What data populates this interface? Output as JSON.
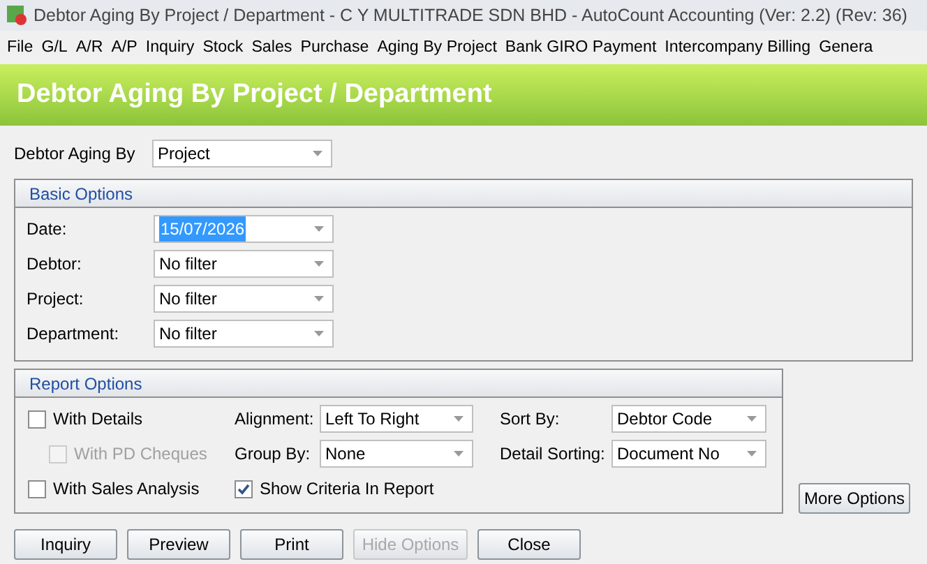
{
  "window": {
    "title": "Debtor Aging By Project / Department - C Y MULTITRADE SDN BHD - AutoCount Accounting (Ver: 2.2) (Rev: 36)"
  },
  "menu": [
    "File",
    "G/L",
    "A/R",
    "A/P",
    "Inquiry",
    "Stock",
    "Sales",
    "Purchase",
    "Aging By Project",
    "Bank GIRO Payment",
    "Intercompany Billing",
    "Genera"
  ],
  "banner": "Debtor Aging By Project / Department",
  "aging_by": {
    "label": "Debtor Aging By",
    "value": "Project"
  },
  "basic_options": {
    "title": "Basic Options",
    "fields": [
      {
        "label": "Date:",
        "value": "15/07/2026",
        "selected": true
      },
      {
        "label": "Debtor:",
        "value": "No filter",
        "selected": false
      },
      {
        "label": "Project:",
        "value": "No filter",
        "selected": false
      },
      {
        "label": "Department:",
        "value": "No filter",
        "selected": false
      }
    ]
  },
  "report_options": {
    "title": "Report Options",
    "checkboxes": [
      {
        "label": "With Details",
        "checked": false,
        "disabled": false,
        "indent": false
      },
      {
        "label": "With PD Cheques",
        "checked": false,
        "disabled": true,
        "indent": true
      },
      {
        "label": "With Sales Analysis",
        "checked": false,
        "disabled": false,
        "indent": false
      }
    ],
    "fields": [
      {
        "label": "Alignment:",
        "value": "Left To Right"
      },
      {
        "label": "Group By:",
        "value": "None"
      }
    ],
    "show_criteria": {
      "label": "Show Criteria In Report",
      "checked": true,
      "disabled": false
    },
    "sort_fields": [
      {
        "label": "Sort By:",
        "value": "Debtor Code"
      },
      {
        "label": "Detail Sorting:",
        "value": "Document No"
      }
    ]
  },
  "more_options": "More Options",
  "buttons": [
    {
      "label": "Inquiry",
      "disabled": false
    },
    {
      "label": "Preview",
      "disabled": false
    },
    {
      "label": "Print",
      "disabled": false
    },
    {
      "label": "Hide Options",
      "disabled": true
    },
    {
      "label": "Close",
      "disabled": false
    }
  ]
}
